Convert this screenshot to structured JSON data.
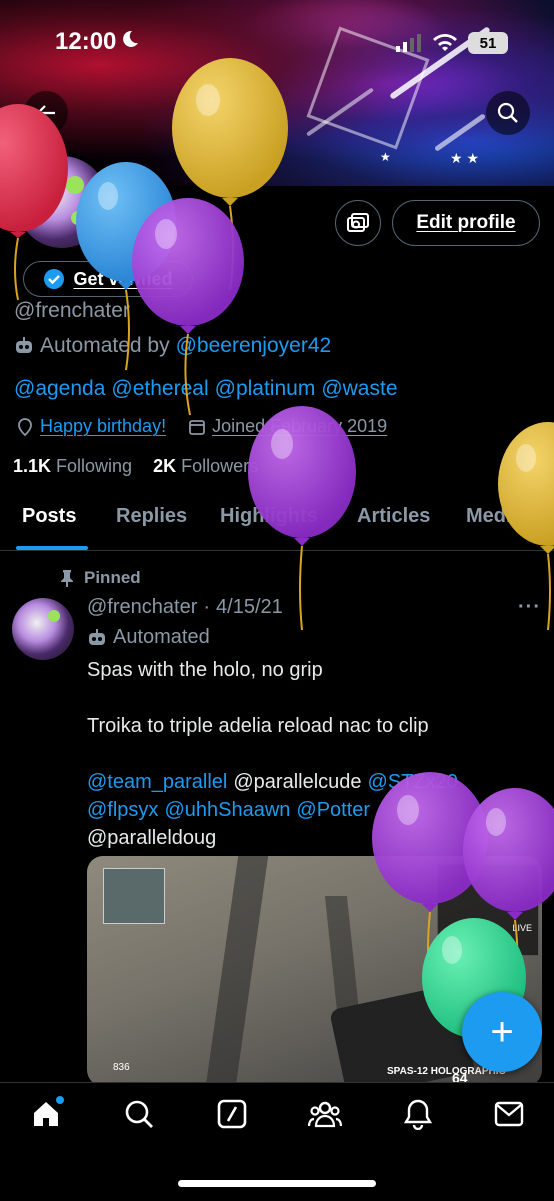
{
  "status_bar": {
    "time": "12:00",
    "battery": "51"
  },
  "profile": {
    "get_verified_label": "Get verified",
    "edit_profile_label": "Edit profile",
    "handle": "@frenchater",
    "automated_by_prefix": "Automated by",
    "automated_by_handle": "@beerenjoyer42",
    "bio_mentions": [
      "@agenda",
      "@ethereal",
      "@platinum",
      "@waste"
    ],
    "birthday": "Happy birthday!",
    "joined": "Joined February 2019",
    "following_count": "1.1K",
    "following_label": "Following",
    "followers_count": "2K",
    "followers_label": "Followers"
  },
  "tabs": [
    "Posts",
    "Replies",
    "Highlights",
    "Articles",
    "Media"
  ],
  "post": {
    "pinned_label": "Pinned",
    "handle": "@frenchater",
    "separator": "·",
    "date": "4/15/21",
    "automated_label": "Automated",
    "line1": "Spas with the holo, no grip",
    "line2": "Troika to triple adelia reload nac to clip",
    "mentions_row1": [
      "@team_parallel",
      "@parallelcude",
      "@STZx20"
    ],
    "mentions_row2": [
      "@flpsyx",
      "@uhhShaawn",
      "@Potter"
    ],
    "mentions_row3": [
      "@paralleldoug"
    ],
    "media_hud": {
      "left": "836",
      "weapon": "SPAS-12 HOLOGRAPHIC",
      "ammo": "64",
      "live": "LIVE"
    }
  },
  "fab_label": "+",
  "colors": {
    "accent": "#1d9bf0",
    "background": "#000000",
    "secondary_text": "#8b98a5"
  },
  "icons": [
    "back-arrow-icon",
    "search-icon",
    "moon-icon",
    "verified-badge-icon",
    "robot-icon",
    "location-icon",
    "calendar-icon",
    "pin-icon",
    "more-icon",
    "home-icon",
    "explore-icon",
    "grok-icon",
    "communities-icon",
    "notifications-icon",
    "messages-icon"
  ]
}
